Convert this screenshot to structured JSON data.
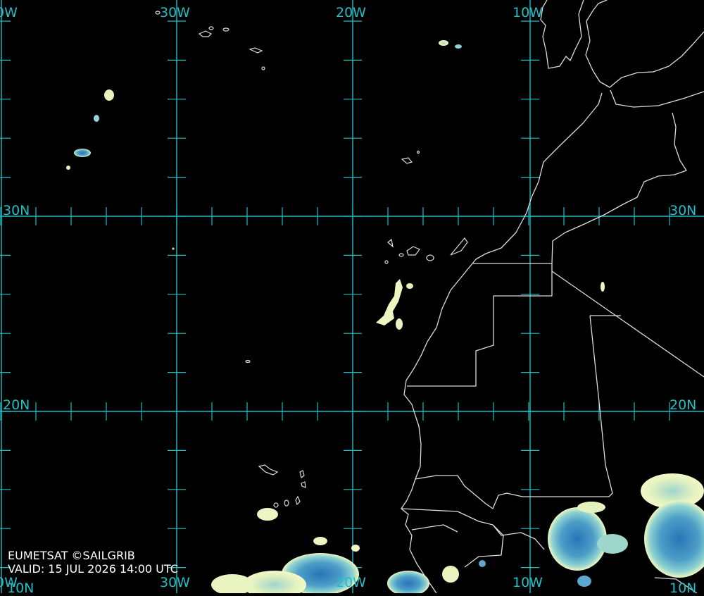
{
  "map": {
    "grid_color": "#1fbfc6",
    "coast_color": "#dcdcdc",
    "cloud_colors": {
      "light": "#f0f6c0",
      "mid": "#8fd2cf",
      "deep": "#2a74b6"
    },
    "top_labels": [
      "0W",
      "30W",
      "20W",
      "10W"
    ],
    "bottom_labels": [
      "0W",
      "30W",
      "20W",
      "10W",
      "10W"
    ],
    "lat_labels": {
      "lat30_left": "30N",
      "lat30_right": "30N",
      "lat20_left": "20N",
      "lat20_right": "20N",
      "bottom_left": "10N",
      "bottom_right": "10N"
    }
  },
  "credits": {
    "source": "EUMETSAT ©SAILGRIB",
    "valid": "VALID:  15 JUL 2026 14:00 UTC"
  }
}
